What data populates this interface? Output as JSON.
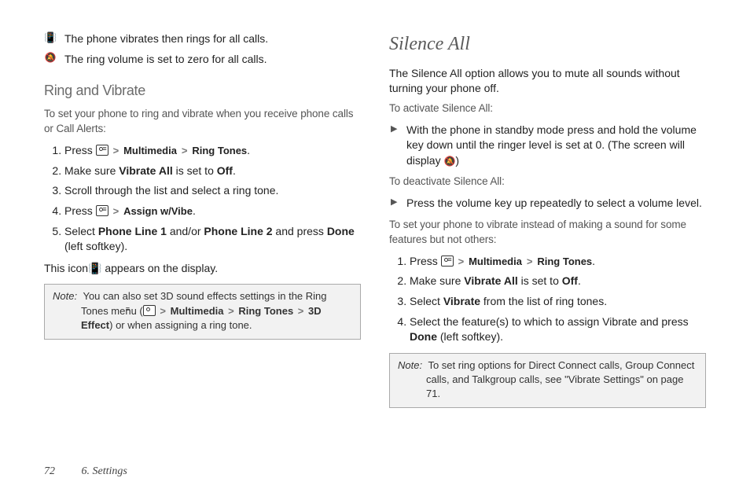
{
  "left": {
    "iconRows": [
      {
        "icon": "📳",
        "text": "The phone vibrates then rings for all calls."
      },
      {
        "icon": "🔕",
        "text": "The ring volume is set to zero for all calls."
      }
    ],
    "section1": "Ring and Vibrate",
    "intro1": "To set your phone to ring and vibrate when you receive phone calls or Call Alerts:",
    "steps1": [
      {
        "pre": "Press ",
        "iconKey": true,
        "path": [
          "Multimedia",
          "Ring Tones"
        ],
        "post": "."
      },
      {
        "plain": "Make sure ",
        "bold1": "Vibrate All",
        "mid": " is set to ",
        "bold2": "Off",
        "post": "."
      },
      {
        "plain": "Scroll through the list and select a ring tone."
      },
      {
        "pre": "Press ",
        "iconKey": true,
        "path": [
          "Assign w/Vibe"
        ],
        "post": "."
      },
      {
        "plain": "Select ",
        "bold1": "Phone Line 1",
        "mid": " and/or ",
        "bold2": "Phone Line 2",
        "mid2": " and press ",
        "bold3": "Done",
        "post": " (left softkey)."
      }
    ],
    "afterSteps": {
      "pre": "This icon",
      "icon": "📳",
      "post": " appears on the display."
    },
    "note1": {
      "label": "Note:",
      "textPre": "You can also set 3D sound effects settings in the Ring Tones menu (",
      "iconKey": true,
      "path": [
        "Multimedia",
        "Ring Tones",
        "3D Effect"
      ],
      "textPost": ") or when assigning a ring tone."
    }
  },
  "right": {
    "title": "Silence All",
    "intro": "The Silence All option allows you to mute all sounds without turning your phone off.",
    "activateLabel": "To activate Silence All:",
    "activateBullet": {
      "pre": "With the phone in standby mode press and hold the volume key down until the ringer level is set at 0. (The screen will display ",
      "icon": "🔕",
      "post": ")"
    },
    "deactivateLabel": "To deactivate Silence All:",
    "deactivateBullet": "Press the volume key up repeatedly to select a volume level.",
    "vibrateIntro": "To set your phone to vibrate instead of making a sound for some features but not others:",
    "steps": [
      {
        "pre": "Press ",
        "iconKey": true,
        "path": [
          "Multimedia",
          "Ring Tones"
        ],
        "post": "."
      },
      {
        "plain": "Make sure ",
        "bold1": "Vibrate All",
        "mid": " is set to ",
        "bold2": "Off",
        "post": "."
      },
      {
        "plain": "Select ",
        "bold1": "Vibrate",
        "post": " from the list of ring tones."
      },
      {
        "plain": "Select the feature(s) to which to assign Vibrate and press ",
        "bold1": "Done",
        "post": " (left softkey)."
      }
    ],
    "note": {
      "label": "Note:",
      "text": "To set ring options for Direct Connect calls, Group Connect calls, and Talkgroup calls, see \"Vibrate Settings\" on page 71."
    }
  },
  "footer": {
    "page": "72",
    "chapter": "6. Settings"
  }
}
